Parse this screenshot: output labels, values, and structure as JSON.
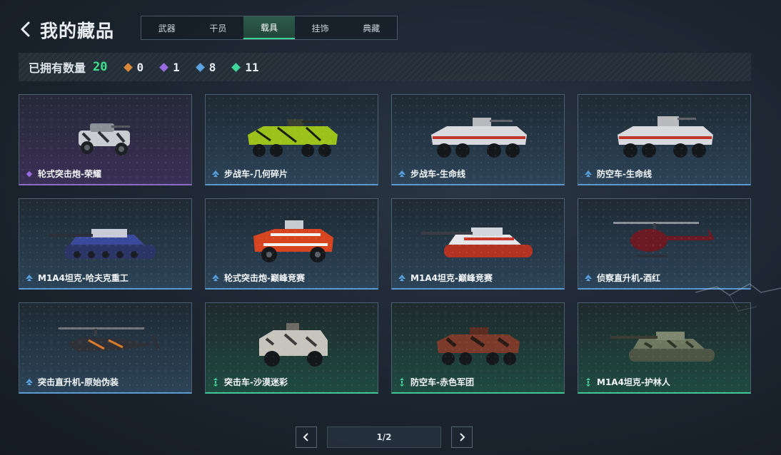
{
  "header": {
    "title": "我的藏品"
  },
  "tabs": [
    {
      "label": "武器",
      "active": false
    },
    {
      "label": "干员",
      "active": false
    },
    {
      "label": "载具",
      "active": true
    },
    {
      "label": "挂饰",
      "active": false
    },
    {
      "label": "典藏",
      "active": false
    }
  ],
  "stats": {
    "owned_label": "已拥有数量",
    "owned_count": "20",
    "rarities": [
      {
        "icon": "orange-gem-icon",
        "color": "#d9873a",
        "count": "0"
      },
      {
        "icon": "purple-gem-icon",
        "color": "#9a6be0",
        "count": "1"
      },
      {
        "icon": "blue-gem-icon",
        "color": "#5aa2e0",
        "count": "8"
      },
      {
        "icon": "green-gem-icon",
        "color": "#3fd49a",
        "count": "11"
      }
    ]
  },
  "items": [
    {
      "name": "轮式突击炮-荣耀",
      "rarity": "purple",
      "icon": "armored-car-icon"
    },
    {
      "name": "步战车-几何碎片",
      "rarity": "blue",
      "icon": "ifv-icon"
    },
    {
      "name": "步战车-生命线",
      "rarity": "blue",
      "icon": "ifv-icon"
    },
    {
      "name": "防空车-生命线",
      "rarity": "blue",
      "icon": "ifv-icon"
    },
    {
      "name": "M1A4坦克-哈夫克重工",
      "rarity": "blue",
      "icon": "tank-icon"
    },
    {
      "name": "轮式突击炮-巅峰竞赛",
      "rarity": "blue",
      "icon": "armored-car-icon"
    },
    {
      "name": "M1A4坦克-巅峰竞赛",
      "rarity": "blue",
      "icon": "tank-icon"
    },
    {
      "name": "侦察直升机-酒红",
      "rarity": "blue",
      "icon": "helicopter-icon"
    },
    {
      "name": "突击直升机-原始伪装",
      "rarity": "blue",
      "icon": "attack-helicopter-icon"
    },
    {
      "name": "突击车-沙漠迷彩",
      "rarity": "green",
      "icon": "assault-car-icon"
    },
    {
      "name": "防空车-赤色军团",
      "rarity": "green",
      "icon": "ifv-icon"
    },
    {
      "name": "M1A4坦克-护林人",
      "rarity": "green",
      "icon": "tank-icon"
    }
  ],
  "pagination": {
    "page": "1/2"
  },
  "colors": {
    "accent": "#3ee08f",
    "purple": "#9a6be0",
    "blue": "#5aa2e0",
    "green": "#3fd49a"
  }
}
